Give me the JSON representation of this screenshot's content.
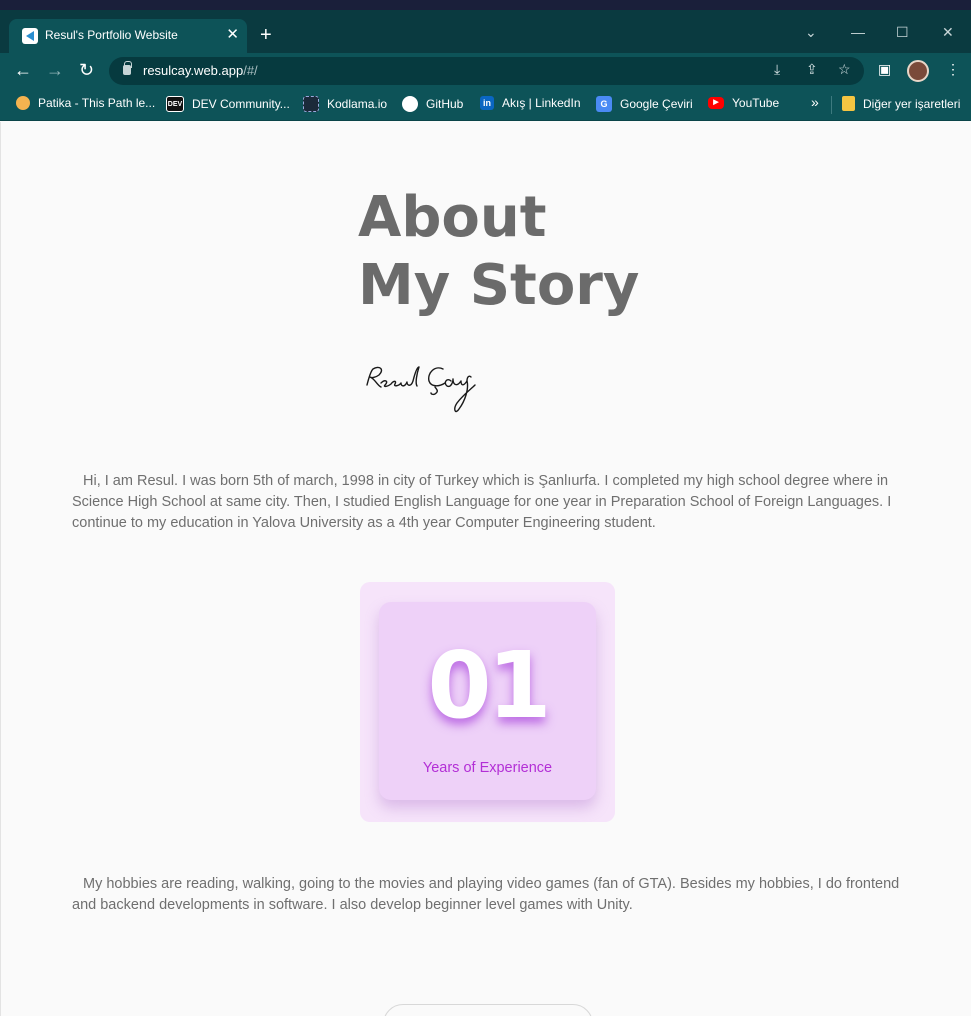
{
  "browser": {
    "tab_title": "Resul's Portfolio Website",
    "tab_close": "✕",
    "new_tab": "+",
    "window_controls": {
      "dropdown": "⌄",
      "minimize": "—",
      "maximize": "☐",
      "close": "✕"
    },
    "nav": {
      "back": "←",
      "forward": "→",
      "reload": "↻"
    },
    "url_host": "resulcay.web.app",
    "url_path": "/#/",
    "omnibox_icons": {
      "install": "⤓",
      "share": "⇪",
      "bookmark": "☆"
    },
    "toolbar_icons": {
      "sidepanel": "▣",
      "menu": "⋮"
    },
    "bookmarks": [
      {
        "label": "Patika - This Path le...",
        "icon": "patika-icon",
        "color": "#f4b350"
      },
      {
        "label": "DEV Community...",
        "icon": "dev-icon",
        "color": "#111111",
        "text": "DEV"
      },
      {
        "label": "Kodlama.io",
        "icon": "kodlama-icon",
        "color": "#1b2a3a"
      },
      {
        "label": "GitHub",
        "icon": "github-icon",
        "color": "#ffffff"
      },
      {
        "label": "Akış | LinkedIn",
        "icon": "linkedin-icon",
        "color": "#0a66c2",
        "text": "in"
      },
      {
        "label": "Google Çeviri",
        "icon": "google-translate-icon",
        "color": "#4a8af4",
        "text": "G"
      },
      {
        "label": "YouTube",
        "icon": "youtube-icon",
        "color": "#ff0000"
      }
    ],
    "bookmarks_overflow": "»",
    "other_bookmarks": "Diğer yer işaretleri"
  },
  "page": {
    "heading_line1": "About",
    "heading_line2": "My Story",
    "paragraph1": "Hi, I am Resul. I was born  5th of march, 1998 in city of Turkey which is Şanlıurfa. I completed my high school degree where in Science High School at same city. Then, I studied English Language for one year in Preparation School of Foreign Languages. I continue to my education in Yalova University as a 4th year Computer Engineering student.",
    "experience_number": "01",
    "experience_label": "Years of Experience",
    "paragraph2": "My hobbies are reading, walking, going to the movies and playing video games (fan of GTA). Besides my hobbies, I do frontend and backend developments in software. I also develop beginner level games with Unity."
  },
  "colors": {
    "tab_bar": "#0a3a40",
    "toolbar": "#0d5358",
    "heading": "#6b6b6b",
    "accent": "#b32fd6",
    "card_outer": "#f6e4fa",
    "card_inner": "#eed1f8"
  }
}
